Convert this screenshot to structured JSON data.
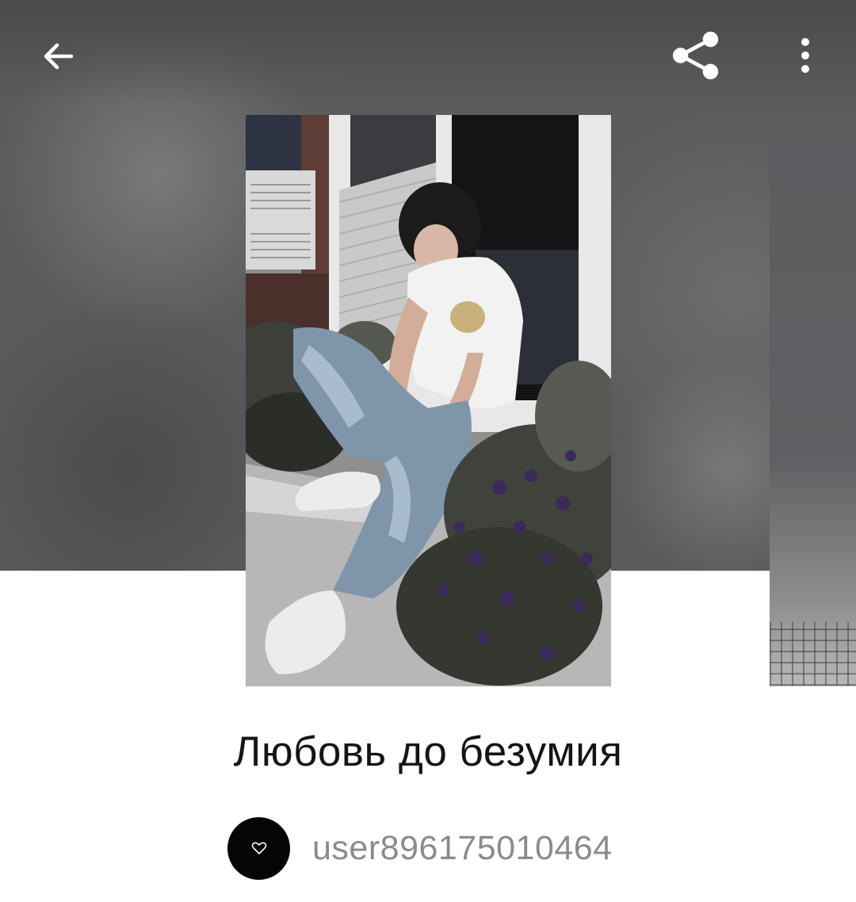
{
  "header": {
    "back_icon": "arrow-left-icon",
    "share_icon": "share-icon",
    "more_icon": "more-vertical-icon"
  },
  "book": {
    "title": "Любовь до безумия",
    "cover_image": "cover-photo",
    "author": {
      "username": "user896175010464",
      "avatar_icon": "heart-icon"
    }
  },
  "colors": {
    "header_backdrop": "#5b5a5c",
    "title_text": "#151515",
    "username_text": "#8b8b8b",
    "avatar_bg": "#050505"
  }
}
